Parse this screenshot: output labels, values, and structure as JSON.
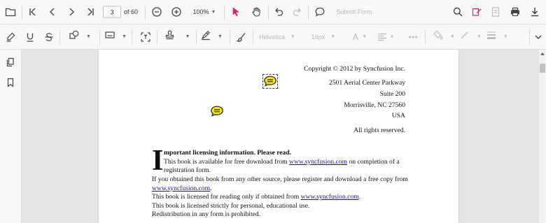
{
  "toolbar": {
    "page_number": "3",
    "page_total": "of 60",
    "zoom_value": "100%",
    "submit_form_label": "Submit Form"
  },
  "annotation_toolbar": {
    "font_family": "Helvetica",
    "font_size": "16px",
    "font_color_label": "A"
  },
  "document": {
    "copyright": "Copyright © 2012 by Syncfusion Inc.",
    "address_line1": "2501 Aerial Center Parkway",
    "address_line2": "Suite 200",
    "address_line3": "Morrisville, NC 27560",
    "address_line4": "USA",
    "rights": "All rights reserved.",
    "dropcap": "I",
    "heading_rest": "mportant licensing information. Please read.",
    "p1_a": "This book is available for free download from ",
    "p1_link": "www.syncfusion.com",
    "p1_b": " on completion of a",
    "p1_c": "registration form.",
    "p2_a": "If you obtained this book from any other source, please register and download a free copy from",
    "p2_link": "www.syncfusion.com",
    "p2_b": ".",
    "p3_a": "This book is licensed for reading only if obtained from ",
    "p3_link": "www.syncfusion.com",
    "p3_b": ".",
    "p4": "This book is licensed strictly for personal, educational use.",
    "p5": "Redistribution in any form is prohibited."
  },
  "colors": {
    "accent_pink": "#e0246b",
    "comment_yellow": "#f5e11c",
    "link_blue": "#1a0dab"
  },
  "icons": [
    "open-file-icon",
    "first-page-icon",
    "previous-page-icon",
    "next-page-icon",
    "last-page-icon",
    "zoom-out-icon",
    "zoom-in-icon",
    "chevron-down-icon",
    "selection-cursor-icon",
    "pan-hand-icon",
    "undo-icon",
    "redo-icon",
    "comment-icon",
    "search-icon",
    "annotation-edit-icon",
    "form-fields-icon",
    "print-icon",
    "download-icon",
    "highlight-icon",
    "underline-icon",
    "strikethrough-icon",
    "shape-icon",
    "calibrate-icon",
    "free-text-icon",
    "stamp-icon",
    "signature-icon",
    "ink-icon",
    "align-icon",
    "more-options-icon",
    "fill-color-icon",
    "stroke-color-icon",
    "thickness-icon",
    "collapse-icon",
    "page-thumbnails-icon",
    "bookmarks-icon"
  ]
}
